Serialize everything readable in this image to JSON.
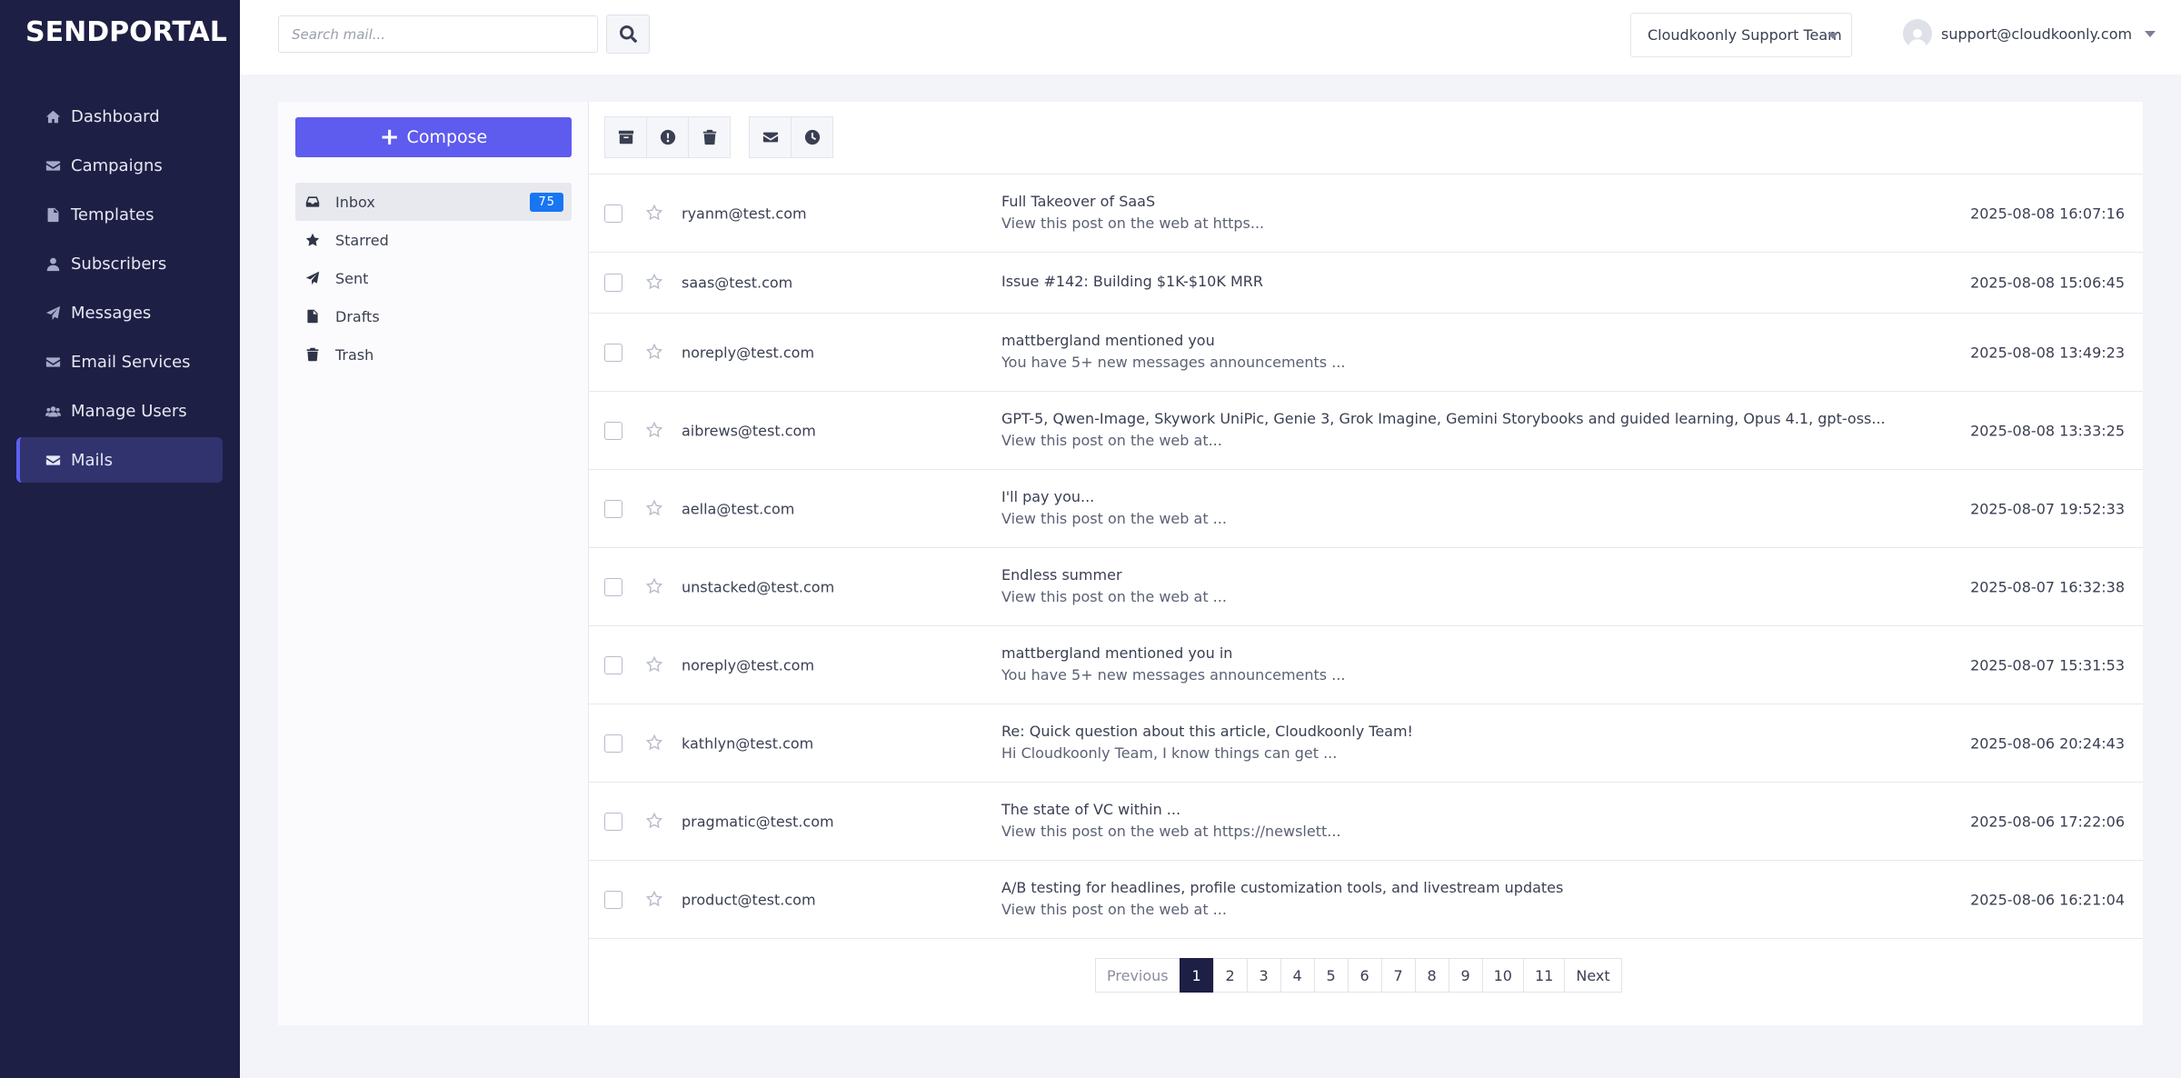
{
  "app": {
    "logo": "SENDPORTAL"
  },
  "sidebar": {
    "items": [
      {
        "label": "Dashboard",
        "icon": "home-icon"
      },
      {
        "label": "Campaigns",
        "icon": "envelope-icon"
      },
      {
        "label": "Templates",
        "icon": "file-icon"
      },
      {
        "label": "Subscribers",
        "icon": "user-icon"
      },
      {
        "label": "Messages",
        "icon": "paper-plane-icon"
      },
      {
        "label": "Email Services",
        "icon": "envelope-icon"
      },
      {
        "label": "Manage Users",
        "icon": "users-icon"
      },
      {
        "label": "Mails",
        "icon": "envelope-icon",
        "active": true
      }
    ]
  },
  "header": {
    "search_placeholder": "Search mail...",
    "team": "Cloudkoonly Support Team",
    "user_email": "support@cloudkoonly.com"
  },
  "folders": {
    "compose_label": "Compose",
    "items": [
      {
        "label": "Inbox",
        "icon": "inbox-icon",
        "badge": "75",
        "active": true
      },
      {
        "label": "Starred",
        "icon": "star-icon"
      },
      {
        "label": "Sent",
        "icon": "paper-plane-icon"
      },
      {
        "label": "Drafts",
        "icon": "file-icon"
      },
      {
        "label": "Trash",
        "icon": "trash-icon"
      }
    ]
  },
  "toolbar": {
    "buttons": [
      "archive-icon",
      "exclamation-icon",
      "trash-icon",
      "envelope-icon",
      "clock-icon"
    ]
  },
  "mails": [
    {
      "from": "ryanm@test.com",
      "subject": "Full Takeover of SaaS",
      "preview": "View this post on the web at https...",
      "date": "2025-08-08 16:07:16"
    },
    {
      "from": "saas@test.com",
      "subject": "Issue #142: Building $1K-$10K MRR",
      "preview": "",
      "date": "2025-08-08 15:06:45"
    },
    {
      "from": "noreply@test.com",
      "subject": "mattbergland mentioned you",
      "preview": "You have 5+ new messages announcements ...",
      "date": "2025-08-08 13:49:23"
    },
    {
      "from": "aibrews@test.com",
      "subject": "GPT-5, Qwen-Image, Skywork UniPic, Genie 3, Grok Imagine, Gemini Storybooks and guided learning, Opus 4.1, gpt-oss...",
      "preview": "View this post on the web at...",
      "date": "2025-08-08 13:33:25"
    },
    {
      "from": "aella@test.com",
      "subject": "I'll pay you...",
      "preview": "View this post on the web at ...",
      "date": "2025-08-07 19:52:33"
    },
    {
      "from": "unstacked@test.com",
      "subject": "Endless summer",
      "preview": "View this post on the web at ...",
      "date": "2025-08-07 16:32:38"
    },
    {
      "from": "noreply@test.com",
      "subject": "mattbergland mentioned you in",
      "preview": "You have 5+ new messages announcements ...",
      "date": "2025-08-07 15:31:53"
    },
    {
      "from": "kathlyn@test.com",
      "subject": "Re: Quick question about this article, Cloudkoonly Team!",
      "preview": "Hi Cloudkoonly Team, I know things can get ...",
      "date": "2025-08-06 20:24:43"
    },
    {
      "from": "pragmatic@test.com",
      "subject": "The state of VC within ...",
      "preview": "View this post on the web at https://newslett...",
      "date": "2025-08-06 17:22:06"
    },
    {
      "from": "product@test.com",
      "subject": "A/B testing for headlines, profile customization tools, and livestream updates",
      "preview": "View this post on the web at ...",
      "date": "2025-08-06 16:21:04"
    }
  ],
  "pagination": {
    "previous": "Previous",
    "pages": [
      "1",
      "2",
      "3",
      "4",
      "5",
      "6",
      "7",
      "8",
      "9",
      "10",
      "11"
    ],
    "current": "1",
    "next": "Next"
  },
  "colors": {
    "sidebar_bg": "#1e1f44",
    "accent": "#5e5bef",
    "badge": "#1876f2"
  }
}
